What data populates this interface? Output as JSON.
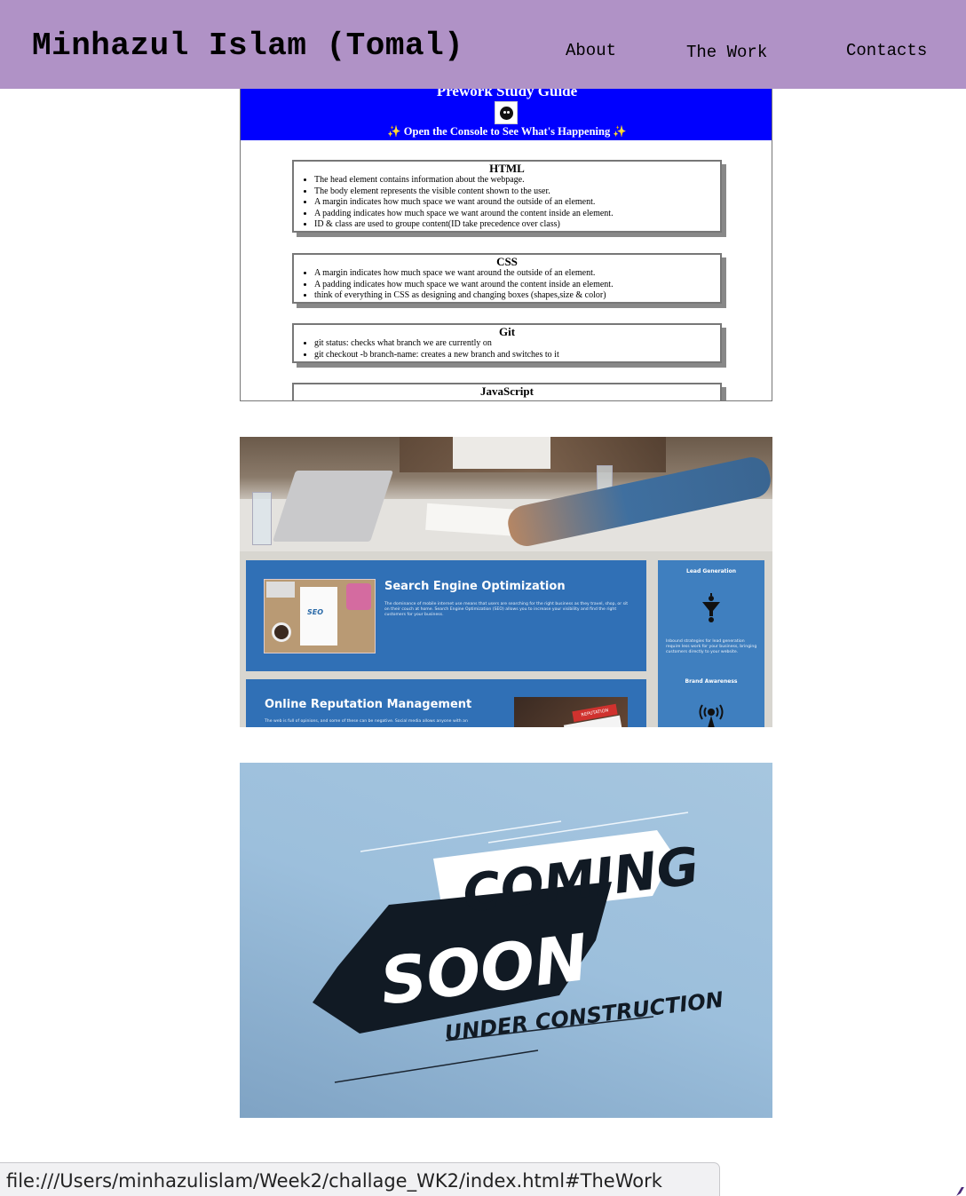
{
  "header": {
    "title": "Minhazul Islam (Tomal)",
    "nav": [
      {
        "label": "About"
      },
      {
        "label": "The Work"
      },
      {
        "label": "Contacts"
      }
    ]
  },
  "work": {
    "prework": {
      "banner_title": "Prework Study Guide",
      "banner_subtitle": "✨ Open the Console to See What's Happening ✨",
      "cards": [
        {
          "heading": "HTML",
          "items": [
            "The head element contains information about the webpage.",
            "The body element represents the visible content shown to the user.",
            "A margin indicates how much space we want around the outside of an element.",
            "A padding indicates how much space we want around the content inside an element.",
            "ID & class are used to groupe content(ID take precedence over class)"
          ]
        },
        {
          "heading": "CSS",
          "items": [
            "A margin indicates how much space we want around the outside of an element.",
            "A padding indicates how much space we want around the content inside an element.",
            "think of everything in CSS as designing and changing boxes (shapes,size & color)"
          ]
        },
        {
          "heading": "Git",
          "items": [
            "git status: checks what branch we are currently on",
            "git checkout -b branch-name: creates a new branch and switches to it"
          ]
        },
        {
          "heading": "JavaScript",
          "items": []
        }
      ]
    },
    "marketing": {
      "seo_title": "Search Engine Optimization",
      "seo_text": "The dominance of mobile internet use means that users are searching for the right business as they travel, shop, or sit on their couch at home. Search Engine Optimization (SEO) allows you to increase your visibility and find the right customers for your business.",
      "seo_image_label": "SEO",
      "orm_title": "Online Reputation Management",
      "orm_text": "The web is full of opinions, and some of these can be negative. Social media allows anyone with an",
      "orm_image_label": "REPUTATION",
      "lead_title": "Lead Generation",
      "lead_text": "Inbound strategies for lead generation require less work for your business, bringing customers directly to your website.",
      "brand_title": "Brand Awareness"
    },
    "coming_soon": {
      "line1": "COMING",
      "line2": "SOON",
      "line3": "UNDER CONSTRUCTION"
    }
  },
  "status_bar": {
    "url": "file:///Users/minhazulislam/Week2/challage_WK2/index.html#TheWork"
  },
  "colors": {
    "header_bg": "#b092c6",
    "prework_banner": "#0000ff",
    "marketing_blue": "#3070b6",
    "coming_soon_bg": "#a6c6df",
    "coming_soon_dark": "#111a24"
  }
}
